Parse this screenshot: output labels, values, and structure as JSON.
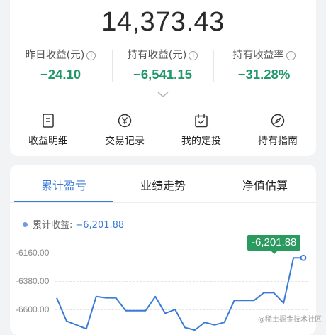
{
  "summary": {
    "total": "14,373.43",
    "metrics": [
      {
        "label": "昨日收益(元)",
        "value": "−24.10"
      },
      {
        "label": "持有收益(元)",
        "value": "−6,541.15"
      },
      {
        "label": "持有收益率",
        "value": "−31.28%"
      }
    ],
    "info_glyph": "i"
  },
  "actions": [
    {
      "label": "收益明细",
      "icon": "document-icon"
    },
    {
      "label": "交易记录",
      "icon": "yen-circle-icon"
    },
    {
      "label": "我的定投",
      "icon": "calendar-check-icon"
    },
    {
      "label": "持有指南",
      "icon": "compass-icon"
    }
  ],
  "tabs": [
    "累计盈亏",
    "业绩走势",
    "净值估算"
  ],
  "legend": {
    "label": "累计收益:",
    "value": "−6,201.88"
  },
  "tooltip": "-6,201.88",
  "watermark": "@稀土掘金技术社区",
  "colors": {
    "accent": "#3a7bd5",
    "positive_green": "#21976a",
    "tooltip_bg": "#2b9a5f",
    "line": "#3a7bd5"
  },
  "chart_data": {
    "type": "line",
    "series": [
      {
        "name": "累计收益",
        "values": [
          -6510,
          -6690,
          -6720,
          -6750,
          -6500,
          -6510,
          -6510,
          -6610,
          -6610,
          -6610,
          -6500,
          -6630,
          -6600,
          -6740,
          -6760,
          -6700,
          -6720,
          -6700,
          -6530,
          -6530,
          -6530,
          -6470,
          -6470,
          -6550,
          -6200,
          -6200
        ]
      }
    ],
    "y_ticks": [
      "-6160.00",
      "-6380.00",
      "-6600.00"
    ],
    "ylim": [
      -6760,
      -6110
    ],
    "grid": true
  }
}
